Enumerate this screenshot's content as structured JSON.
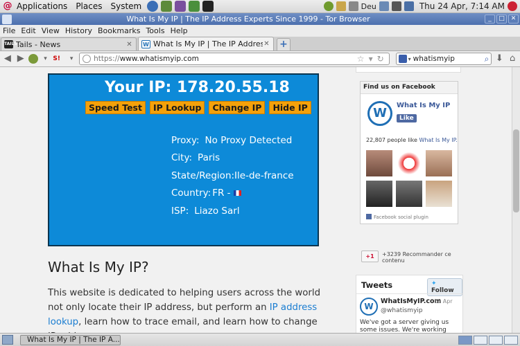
{
  "panel": {
    "menus": [
      "Applications",
      "Places",
      "System"
    ],
    "keyboard": "Deu",
    "clock": "Thu 24 Apr,  7:14 AM"
  },
  "window": {
    "title": "What Is My IP | The IP Address Experts Since 1999 - Tor Browser"
  },
  "menubar": [
    "File",
    "Edit",
    "View",
    "History",
    "Bookmarks",
    "Tools",
    "Help"
  ],
  "tabs": [
    {
      "label": "Tails - News",
      "favicon": "TAILS"
    },
    {
      "label": "What Is My IP | The IP Address E...",
      "favicon": "W"
    }
  ],
  "nav": {
    "url_scheme": "https://",
    "url_host": "www.whatismyip.com",
    "search_value": "whatismyip"
  },
  "page": {
    "ip_title": "Your IP: 178.20.55.18",
    "buttons": [
      "Speed Test",
      "IP Lookup",
      "Change IP",
      "Hide IP"
    ],
    "details": [
      {
        "label": "Proxy:",
        "value": "No Proxy Detected"
      },
      {
        "label": "City:",
        "value": "Paris"
      },
      {
        "label": "State/Region:",
        "value": "Ile-de-france"
      },
      {
        "label": "Country:",
        "value": "FR -"
      },
      {
        "label": "ISP:",
        "value": "Liazo Sarl"
      }
    ],
    "article_title": "What Is My IP?",
    "article_p1": "This website is dedicated to helping users across the world not only locate their IP address, but perform an ",
    "article_link": "IP address lookup",
    "article_p2": ", learn how to trace email, and learn how to change IP address."
  },
  "sidebar": {
    "fb_header": "Find us on Facebook",
    "fb_page_name": "What Is My IP",
    "fb_like": "Like",
    "fb_count_text": "22,807 people like ",
    "fb_count_link": "What Is My IP.",
    "fb_plugin": "Facebook social plugin",
    "gplus_label": "+1",
    "gplus_count": "+3239  Recommander ce contenu",
    "tw_header": "Tweets",
    "tw_follow": "Follow",
    "tw_name": "WhatIsMyIP.com",
    "tw_date": "18 Apr",
    "tw_handle": "@whatismyip",
    "tw_text": "We've got a server giving us some issues.  We're working"
  },
  "taskbar": {
    "window_button": "What Is My IP | The IP A..."
  },
  "colors": {
    "ip_box": "#0d8ad8",
    "ip_button": "#f5a10a",
    "link": "#1a7dd1",
    "facebook": "#3b5998"
  }
}
